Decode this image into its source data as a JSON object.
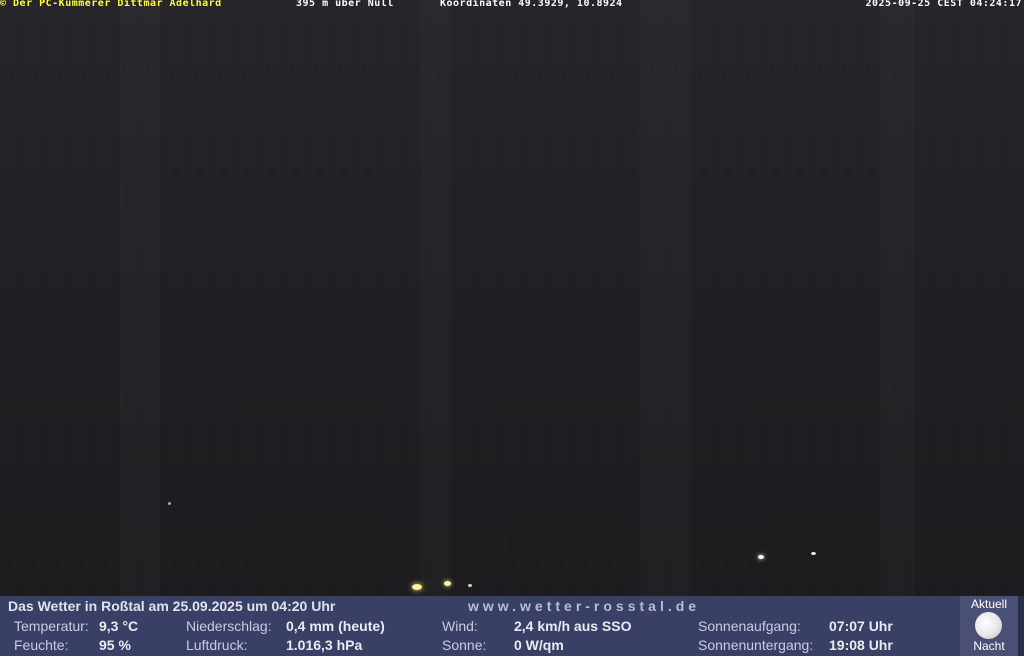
{
  "overlay": {
    "copyright": "© Der PC-Kümmerer Dittmar Adelhard",
    "elevation": "395 m über Null",
    "coordinates": "Koordinaten 49.3929, 10.8924",
    "timestamp": "2025-09-25 CEST 04:24:17"
  },
  "weather": {
    "title": "Das Wetter in Roßtal am 25.09.2025 um 04:20 Uhr",
    "website": "www.wetter-rosstal.de",
    "temperature_label": "Temperatur:",
    "temperature_value": "9,3 °C",
    "humidity_label": "Feuchte:",
    "humidity_value": "95 %",
    "precip_label": "Niederschlag:",
    "precip_value": "0,4 mm (heute)",
    "pressure_label": "Luftdruck:",
    "pressure_value": "1.016,3 hPa",
    "wind_label": "Wind:",
    "wind_value": "2,4 km/h aus SSO",
    "sun_label": "Sonne:",
    "sun_value": "0 W/qm",
    "sunrise_label": "Sonnenaufgang:",
    "sunrise_value": "07:07 Uhr",
    "sunset_label": "Sonnenuntergang:",
    "sunset_value": "19:08 Uhr"
  },
  "badge": {
    "top": "Aktuell",
    "bottom": "Nacht",
    "icon": "moon-icon"
  },
  "colors": {
    "overlay_highlight": "#ffff33",
    "panel_background": "#3a3f66"
  }
}
